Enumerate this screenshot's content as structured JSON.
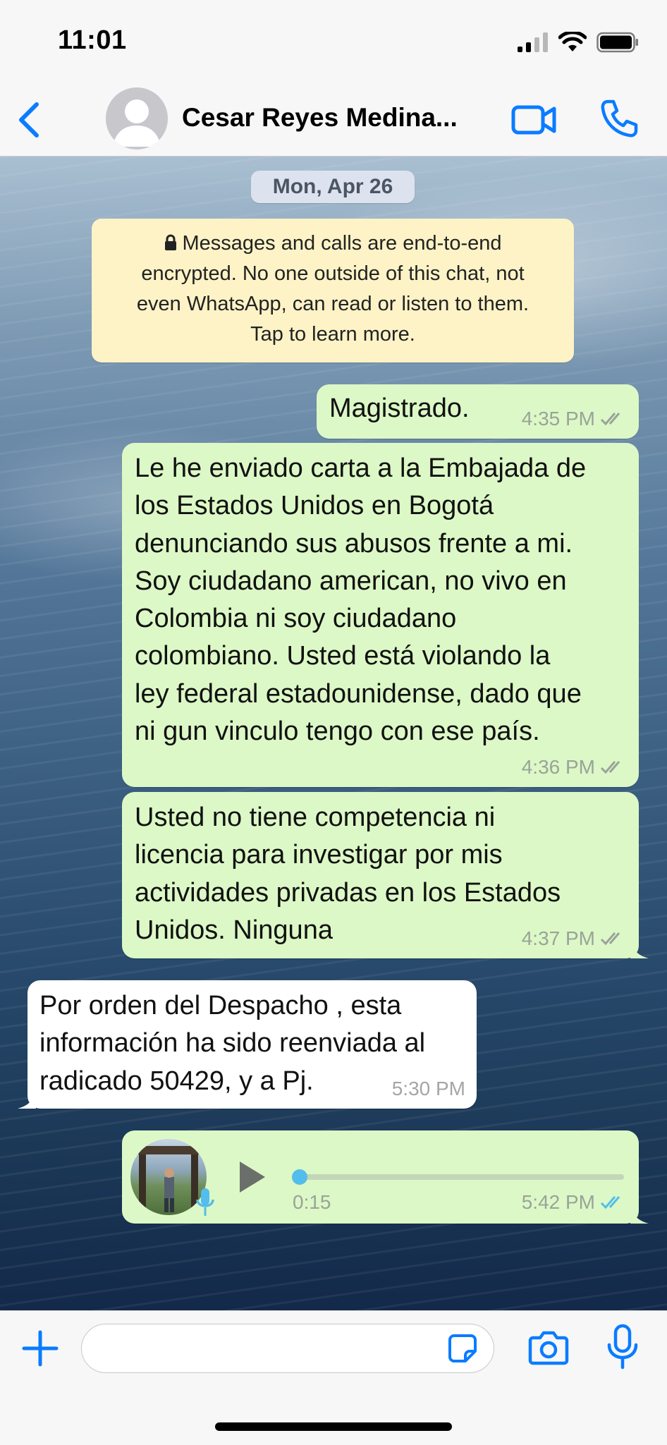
{
  "status_bar": {
    "time": "11:01"
  },
  "header": {
    "contact_name": "Cesar Reyes Medina..."
  },
  "chat": {
    "date_label": "Mon, Apr 26",
    "encryption_notice": [
      "Messages and calls are end-to-end",
      "encrypted. No one outside of this chat, not",
      "even WhatsApp, can read or listen to them.",
      "Tap to learn more."
    ],
    "messages": [
      {
        "direction": "out",
        "lines": [
          "Magistrado."
        ],
        "time": "4:35 PM",
        "status": "read"
      },
      {
        "direction": "out",
        "lines": [
          "Le he enviado carta a la Embajada de",
          "los Estados Unidos en Bogotá",
          "denunciando sus abusos frente a mi.",
          "Soy ciudadano american, no vivo en",
          "Colombia ni soy ciudadano",
          "colombiano. Usted está violando la",
          "ley federal estadounidense, dado que",
          "ni gun vinculo tengo con ese país."
        ],
        "time": "4:36 PM",
        "status": "read"
      },
      {
        "direction": "out",
        "lines": [
          "Usted no tiene competencia ni",
          "licencia para investigar por mis",
          "actividades privadas en los Estados",
          "Unidos. Ninguna"
        ],
        "time": "4:37 PM",
        "status": "read"
      },
      {
        "direction": "in",
        "lines": [
          "Por orden del Despacho , esta",
          "información ha sido reenviada al",
          "radicado 50429, y a Pj."
        ],
        "time": "5:30 PM"
      }
    ],
    "voice_note": {
      "duration": "0:15",
      "time": "5:42 PM",
      "status": "read",
      "progress": 0,
      "icons": [
        "play-icon",
        "mic-icon"
      ]
    }
  },
  "input_bar": {
    "placeholder": "",
    "icons": [
      "plus-icon",
      "sticker-icon",
      "camera-icon",
      "mic-icon"
    ]
  },
  "colors": {
    "accent": "#0a7cff",
    "outgoing_bubble": "#dcf8c6",
    "incoming_bubble": "#ffffff",
    "read_tick": "#53bdeb"
  }
}
